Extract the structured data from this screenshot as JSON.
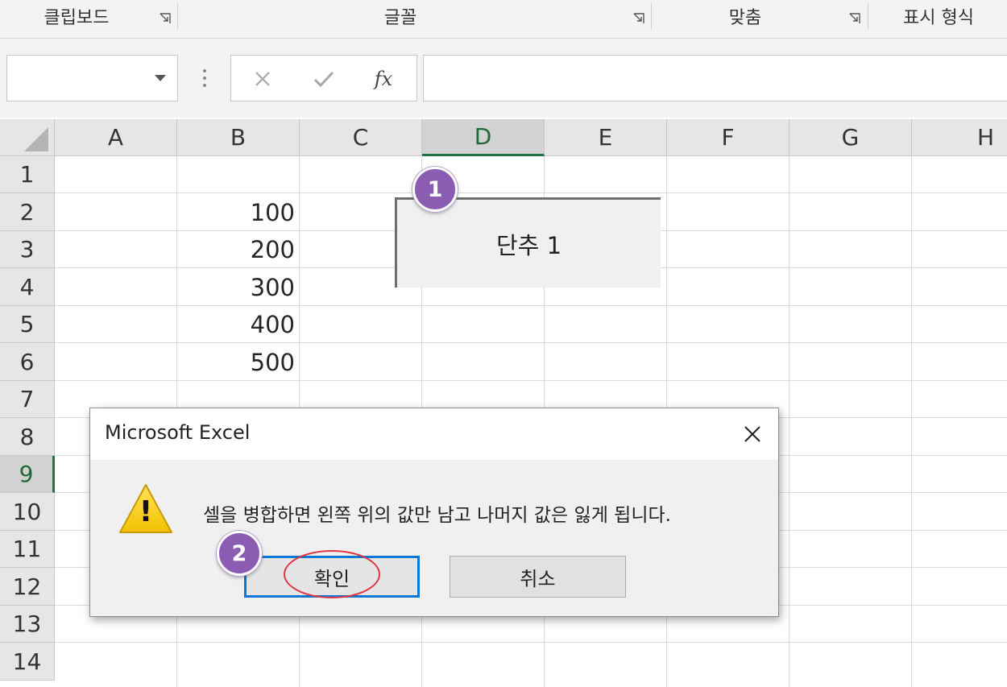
{
  "ribbon": {
    "groups": [
      "클립보드",
      "글꼴",
      "맞춤",
      "표시 형식"
    ]
  },
  "formula_bar": {
    "name_box_value": "",
    "cancel_icon": "x-icon",
    "enter_icon": "check-icon",
    "fx_label": "fx",
    "formula_value": ""
  },
  "grid": {
    "columns": [
      "A",
      "B",
      "C",
      "D",
      "E",
      "F",
      "G",
      "H"
    ],
    "rows": [
      "1",
      "2",
      "3",
      "4",
      "5",
      "6",
      "7",
      "8",
      "9",
      "10",
      "11",
      "12",
      "13",
      "14"
    ],
    "selected_column": "D",
    "selected_row": "9",
    "b_column_values": [
      "100",
      "200",
      "300",
      "400",
      "500"
    ]
  },
  "form_button": {
    "label": "단추 1"
  },
  "steps": [
    "1",
    "2"
  ],
  "dialog": {
    "title": "Microsoft Excel",
    "message": "셀을 병합하면 왼쪽 위의 값만 남고 나머지 값은 잃게 됩니다.",
    "ok_label": "확인",
    "cancel_label": "취소",
    "warning_symbol": "!"
  },
  "colors": {
    "accent_green": "#217346",
    "step_purple": "#8a5db3",
    "focus_blue": "#0a78d7",
    "highlight_red": "#e0353f"
  }
}
